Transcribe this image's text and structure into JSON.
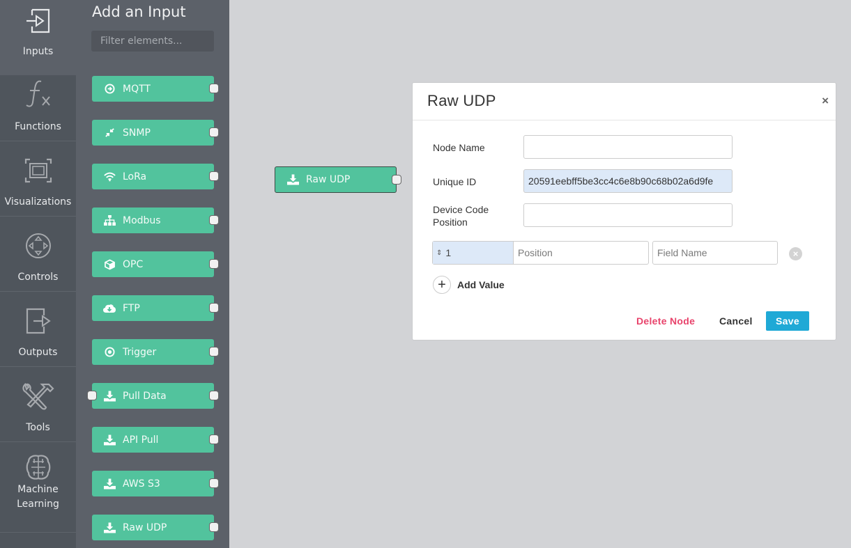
{
  "sidebar": {
    "categories": [
      {
        "label": "Inputs",
        "icon": "input-arrow-icon",
        "active": true
      },
      {
        "label": "Functions",
        "icon": "function-fx-icon"
      },
      {
        "label": "Visualizations",
        "icon": "visualization-frame-icon"
      },
      {
        "label": "Controls",
        "icon": "dpad-control-icon"
      },
      {
        "label": "Outputs",
        "icon": "output-arrow-icon"
      },
      {
        "label": "Tools",
        "icon": "wrench-hammer-icon"
      },
      {
        "label": "Machine",
        "label2": "Learning",
        "icon": "brain-icon"
      }
    ]
  },
  "palette": {
    "title": "Add an Input",
    "filter_placeholder": "Filter elements...",
    "nodes": [
      {
        "label": "MQTT",
        "icon": "arrow-circle-right-icon"
      },
      {
        "label": "SNMP",
        "icon": "compress-arrows-icon"
      },
      {
        "label": "LoRa",
        "icon": "wifi-icon"
      },
      {
        "label": "Modbus",
        "icon": "sitemap-icon"
      },
      {
        "label": "OPC",
        "icon": "cube-icon"
      },
      {
        "label": "FTP",
        "icon": "cloud-download-icon"
      },
      {
        "label": "Trigger",
        "icon": "dot-circle-icon"
      },
      {
        "label": "Pull Data",
        "icon": "download-icon"
      },
      {
        "label": "API Pull",
        "icon": "download-icon"
      },
      {
        "label": "AWS S3",
        "icon": "download-icon"
      },
      {
        "label": "Raw UDP",
        "icon": "download-icon"
      }
    ]
  },
  "canvas": {
    "node": {
      "label": "Raw UDP",
      "icon": "download-icon"
    }
  },
  "dialog": {
    "title": "Raw UDP",
    "close": "×",
    "fields": {
      "node_name": {
        "label": "Node Name",
        "value": ""
      },
      "unique_id": {
        "label": "Unique ID",
        "value": "20591eebff5be3cc4c6e8b90c68b02a6d9fe"
      },
      "device_code_position": {
        "label_line1": "Device Code",
        "label_line2": "Position",
        "value": ""
      }
    },
    "value_rows": [
      {
        "index": "1",
        "position_placeholder": "Position",
        "field_name_placeholder": "Field Name"
      }
    ],
    "add_value_label": "Add Value",
    "delete_label": "Delete Node",
    "cancel_label": "Cancel",
    "save_label": "Save"
  },
  "colors": {
    "node_green": "#52c39d",
    "save_blue": "#1fa9d6",
    "delete_red": "#e8436b",
    "readonly_blue": "#dde9f8"
  }
}
